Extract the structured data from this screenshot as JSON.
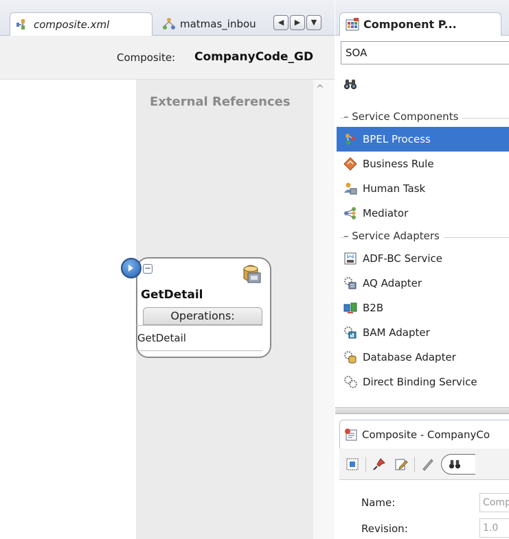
{
  "left_editor": {
    "tabs": [
      {
        "label": "composite.xml",
        "active": true,
        "icon": "composite-icon"
      },
      {
        "label": "matmas_inbou",
        "active": false,
        "icon": "mediator-icon"
      }
    ],
    "nav_buttons": [
      "scroll-left",
      "scroll-right",
      "tab-list"
    ],
    "composite_label": "Composite:",
    "composite_name": "CompanyCode_GD",
    "external_references_header": "External References",
    "component": {
      "name": "GetDetail",
      "operations_header": "Operations:",
      "operations": [
        "GetDetail"
      ]
    }
  },
  "component_palette": {
    "tab_title": "Component P...",
    "selected_category": "SOA",
    "search_placeholder": "",
    "sections": [
      {
        "title": "Service Components",
        "items": [
          {
            "label": "BPEL Process",
            "icon": "bpel-process-icon",
            "selected": true
          },
          {
            "label": "Business Rule",
            "icon": "business-rule-icon",
            "selected": false
          },
          {
            "label": "Human Task",
            "icon": "human-task-icon",
            "selected": false
          },
          {
            "label": "Mediator",
            "icon": "mediator-icon",
            "selected": false
          }
        ]
      },
      {
        "title": "Service Adapters",
        "items": [
          {
            "label": "ADF-BC Service",
            "icon": "adf-bc-service-icon",
            "selected": false
          },
          {
            "label": "AQ Adapter",
            "icon": "aq-adapter-icon",
            "selected": false
          },
          {
            "label": "B2B",
            "icon": "b2b-icon",
            "selected": false
          },
          {
            "label": "BAM Adapter",
            "icon": "bam-adapter-icon",
            "selected": false
          },
          {
            "label": "Database Adapter",
            "icon": "database-adapter-icon",
            "selected": false
          },
          {
            "label": "Direct Binding Service",
            "icon": "direct-binding-icon",
            "selected": false
          }
        ]
      }
    ]
  },
  "properties": {
    "tab_title": "Composite - CompanyCo",
    "fields": [
      {
        "label": "Name:",
        "value": "Comp"
      },
      {
        "label": "Revision:",
        "value": "1.0"
      }
    ]
  },
  "colors": {
    "selection": "#3876d0",
    "tab_bar": "#e3e6ee",
    "reference_column": "#ebebeb",
    "service_circle": "#1e5fae"
  }
}
